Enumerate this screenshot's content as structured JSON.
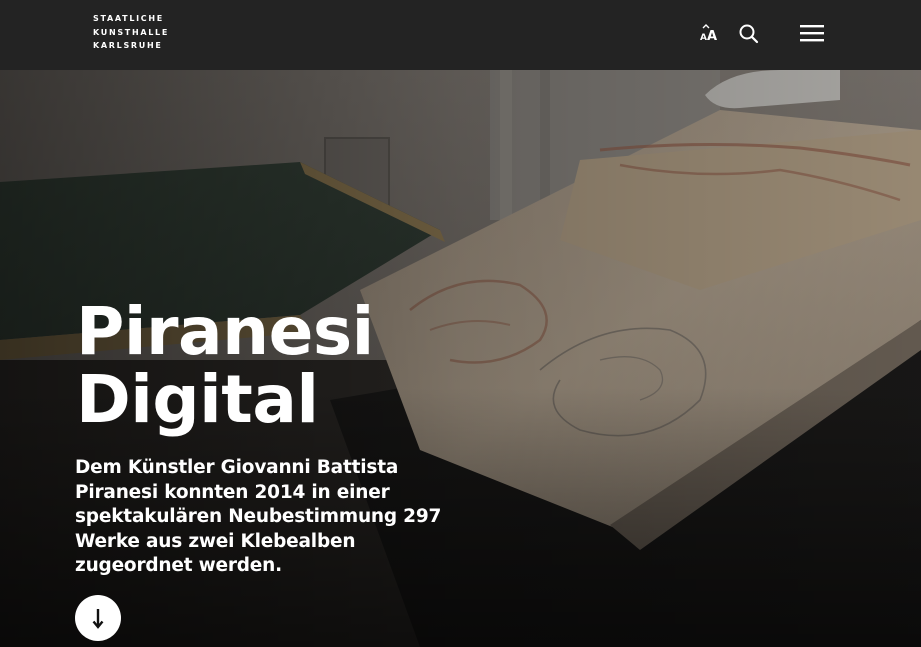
{
  "header": {
    "logo_lines": [
      "STAATLICHE",
      "KUNSTHALLE",
      "KARLSRUHE"
    ],
    "icons": {
      "text_size": "text-size-icon",
      "search": "search-icon",
      "menu": "hamburger-menu-icon"
    }
  },
  "hero": {
    "title_lines": [
      "Piranesi",
      "Digital"
    ],
    "description": "Dem Künstler Giovanni Battista Piranesi konnten 2014 in einer spektakulären Neubestimmung 297 Werke aus zwei Klebealben zugeordnet werden.",
    "scroll_icon": "arrow-down-icon"
  },
  "colors": {
    "header_bg": "#232323",
    "text": "#ffffff",
    "button_bg": "#ffffff"
  }
}
